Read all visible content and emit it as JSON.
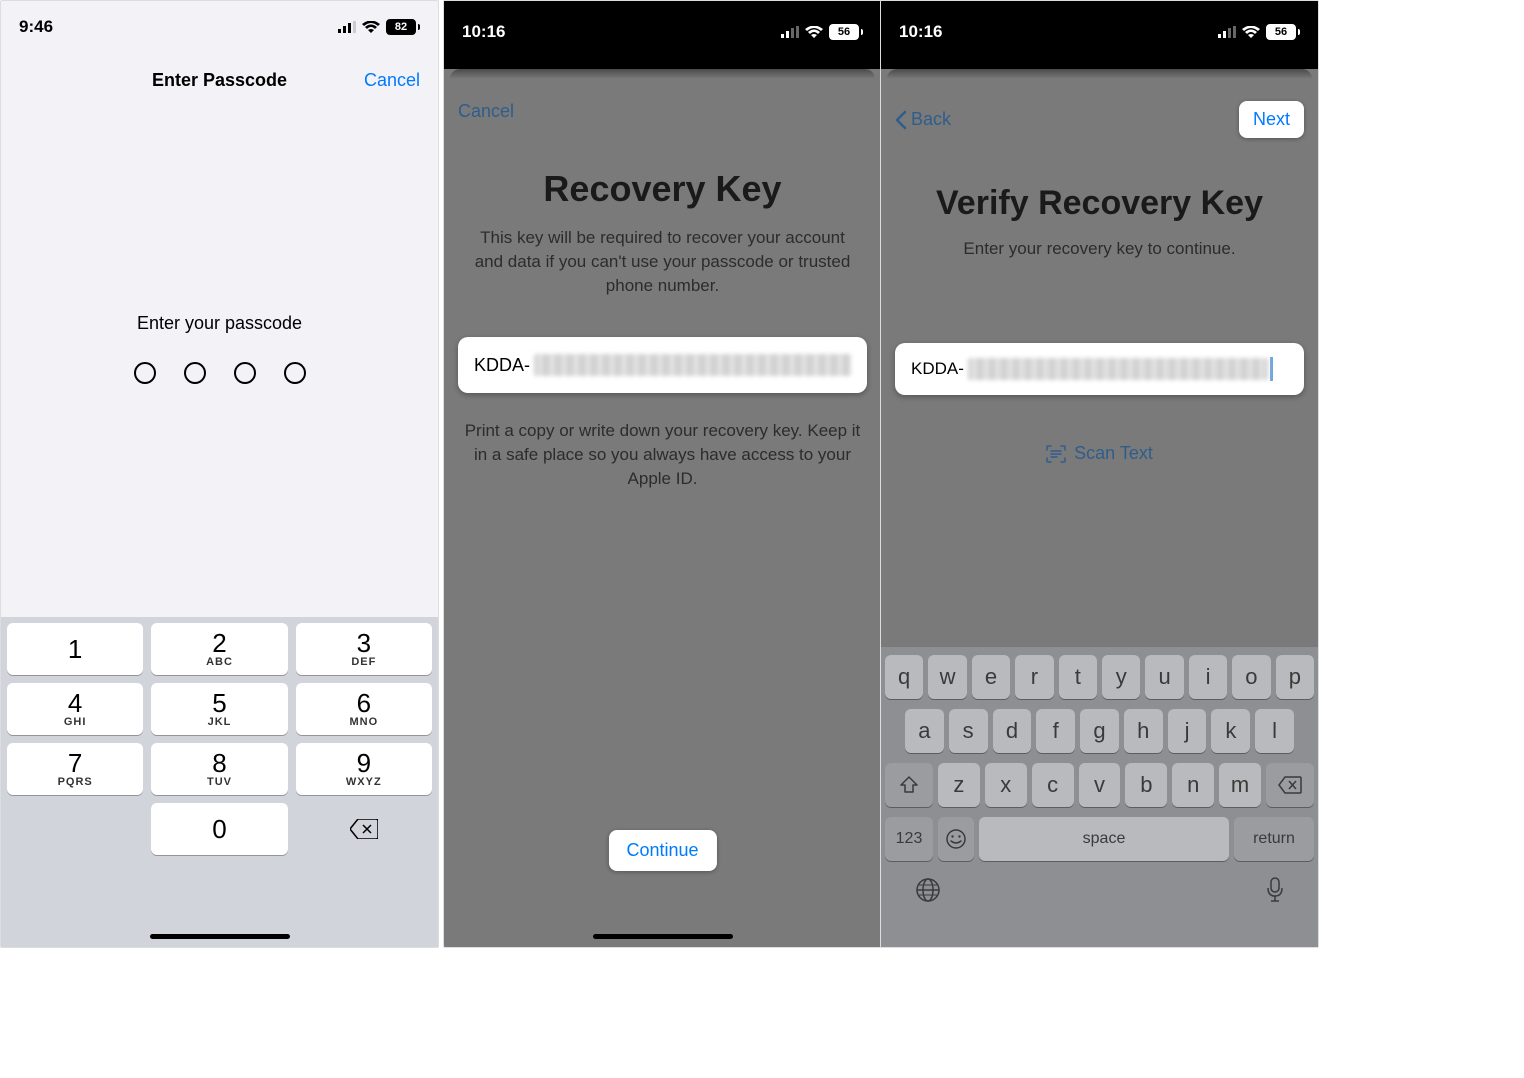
{
  "screen1": {
    "time": "9:46",
    "battery": "82",
    "title": "Enter Passcode",
    "cancel": "Cancel",
    "prompt": "Enter your passcode",
    "keypad": {
      "k1": {
        "n": "1",
        "s": ""
      },
      "k2": {
        "n": "2",
        "s": "ABC"
      },
      "k3": {
        "n": "3",
        "s": "DEF"
      },
      "k4": {
        "n": "4",
        "s": "GHI"
      },
      "k5": {
        "n": "5",
        "s": "JKL"
      },
      "k6": {
        "n": "6",
        "s": "MNO"
      },
      "k7": {
        "n": "7",
        "s": "PQRS"
      },
      "k8": {
        "n": "8",
        "s": "TUV"
      },
      "k9": {
        "n": "9",
        "s": "WXYZ"
      },
      "k0": {
        "n": "0",
        "s": ""
      }
    }
  },
  "screen2": {
    "time": "10:16",
    "battery": "56",
    "cancel": "Cancel",
    "title": "Recovery Key",
    "desc": "This key will be required to recover your account and data if you can't use your passcode or trusted phone number.",
    "key_prefix": "KDDA-",
    "note": "Print a copy or write down your recovery key. Keep it in a safe place so you always have access to your Apple ID.",
    "continue": "Continue"
  },
  "screen3": {
    "time": "10:16",
    "battery": "56",
    "back": "Back",
    "next": "Next",
    "title": "Verify Recovery Key",
    "desc": "Enter your recovery key to continue.",
    "input_prefix": "KDDA-",
    "scan": "Scan Text",
    "keyboard": {
      "row1": [
        "q",
        "w",
        "e",
        "r",
        "t",
        "y",
        "u",
        "i",
        "o",
        "p"
      ],
      "row2": [
        "a",
        "s",
        "d",
        "f",
        "g",
        "h",
        "j",
        "k",
        "l"
      ],
      "row3": [
        "z",
        "x",
        "c",
        "v",
        "b",
        "n",
        "m"
      ],
      "k123": "123",
      "space": "space",
      "return": "return"
    }
  }
}
